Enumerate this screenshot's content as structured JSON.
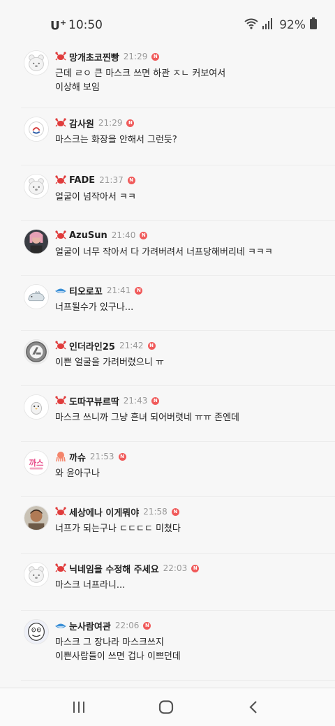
{
  "status_bar": {
    "carrier": "U",
    "carrier_sup": "+",
    "time": "10:50",
    "battery": "92%"
  },
  "comments": [
    {
      "nickname": "망개초코찐빵",
      "time": "21:29",
      "new": "N",
      "text": "근데 ㄹㅇ 큰 마스크 쓰면 하관 ㅈㄴ 커보여서\n이상해 보임",
      "badge": "crab-icon",
      "avatar": "default"
    },
    {
      "nickname": "감사원",
      "time": "21:29",
      "new": "N",
      "text": "마스크는 화장을 안해서 그런듯?",
      "badge": "crab-icon",
      "avatar": "logo"
    },
    {
      "nickname": "FADE",
      "time": "21:37",
      "new": "N",
      "text": "얼굴이 넘작아서 ㅋㅋ",
      "badge": "crab-icon",
      "avatar": "default"
    },
    {
      "nickname": "AzuSun",
      "time": "21:40",
      "new": "N",
      "text": "얼굴이 너무 작아서 다 가려버려서 너프당해버리네 ㅋㅋㅋ",
      "badge": "crab-icon",
      "avatar": "photo"
    },
    {
      "nickname": "티오로꼬",
      "time": "21:41",
      "new": "N",
      "text": "너프될수가 있구나...",
      "badge": "fish-icon",
      "avatar": "dino"
    },
    {
      "nickname": "인더라인25",
      "time": "21:42",
      "new": "N",
      "text": "이쁜 얼굴을 가려버렸으니 ㅠ",
      "badge": "crab-icon",
      "avatar": "coin"
    },
    {
      "nickname": "도따꾸뷰르딱",
      "time": "21:43",
      "new": "N",
      "text": "마스크 쓰니까 그냥 흔녀 되어버렷네 ㅠㅠ 존엔데",
      "badge": "crab-icon",
      "avatar": "penguin"
    },
    {
      "nickname": "까슈",
      "time": "21:53",
      "new": "N",
      "text": "와 윤아구나",
      "badge": "octopus-icon",
      "avatar": "text-logo",
      "avatar_text": "까스"
    },
    {
      "nickname": "세상에나 이게뭐야",
      "time": "21:58",
      "new": "N",
      "text": "너프가 되는구나 ㄷㄷㄷㄷ 미쳤다",
      "badge": "crab-icon",
      "avatar": "man"
    },
    {
      "nickname": "닉네임을 수정해 주세요",
      "time": "22:03",
      "new": "N",
      "text": "마스크 너프라니...",
      "badge": "crab-icon",
      "avatar": "default"
    },
    {
      "nickname": "눈사람여관",
      "time": "22:06",
      "new": "N",
      "text": "마스크 그 장나라 마스크쓰지\n이쁜사람들이 쓰면 겁나 이쁘던데",
      "badge": "fish-icon",
      "avatar": "cartoon"
    }
  ],
  "nav": {
    "recent": "recent-apps-icon",
    "home": "home-icon",
    "back": "back-icon"
  }
}
